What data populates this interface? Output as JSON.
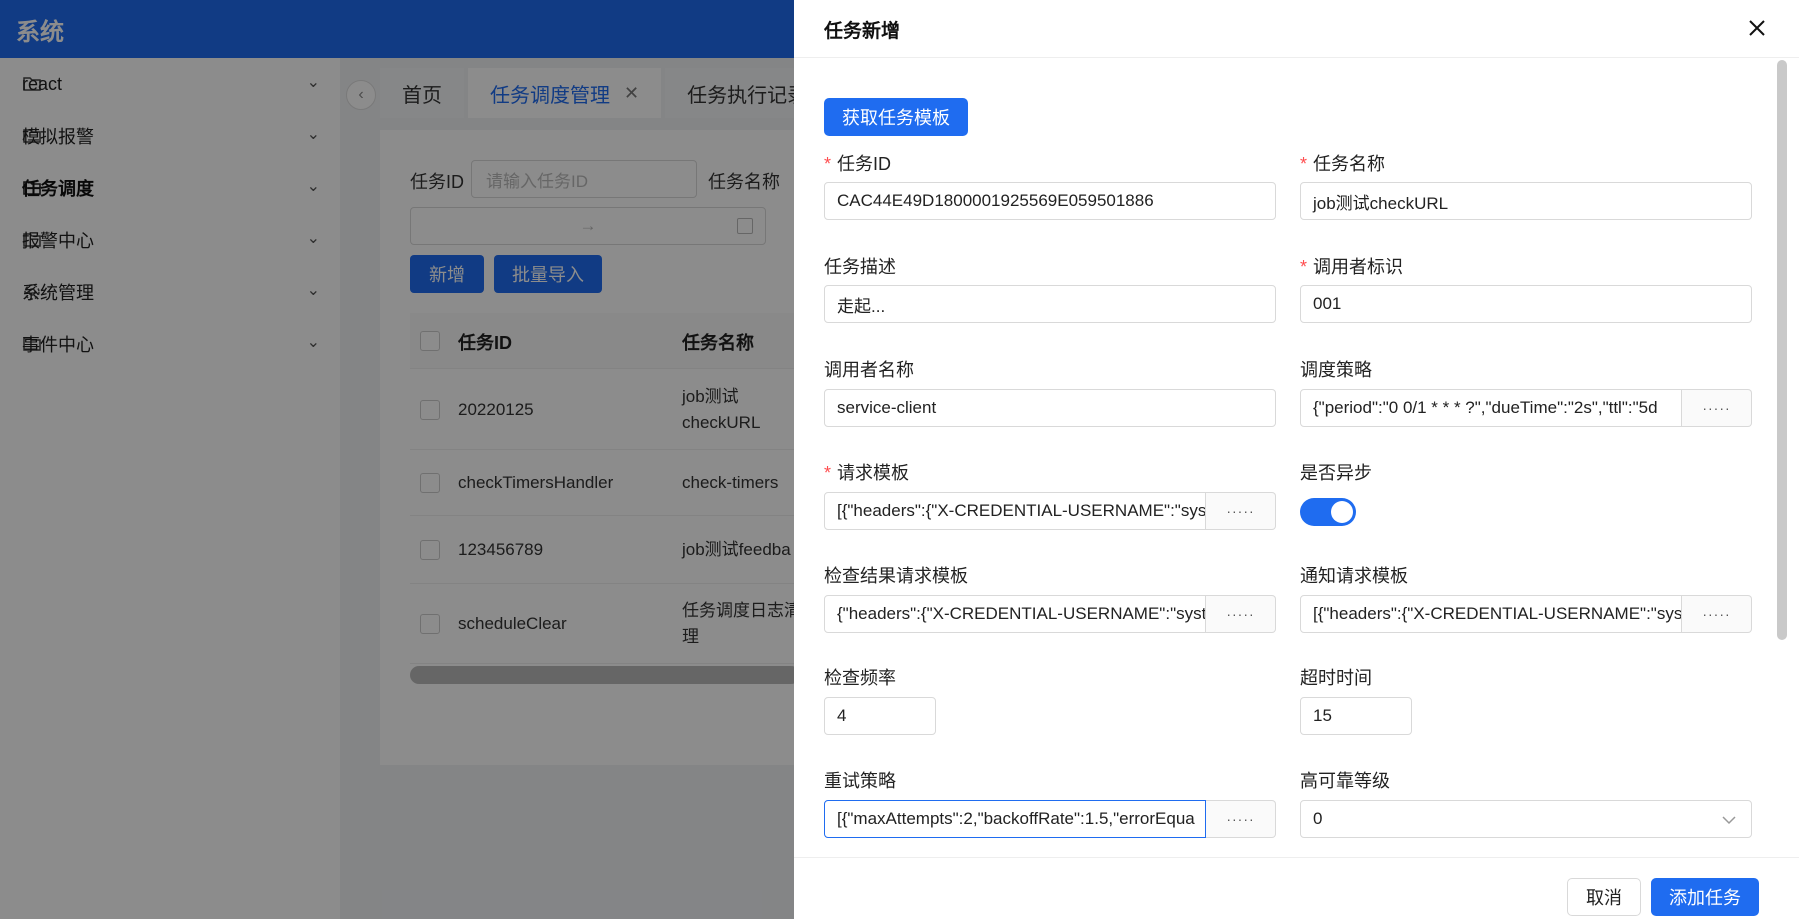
{
  "app": {
    "title": "系统"
  },
  "sidebar": {
    "items": [
      {
        "label": "react",
        "icon": "folder-icon"
      },
      {
        "label": "模拟报警",
        "icon": "folder-icon"
      },
      {
        "label": "任务调度",
        "icon": "folder-icon"
      },
      {
        "label": "报警中心",
        "icon": "folder-icon"
      },
      {
        "label": "系统管理",
        "icon": "gear-icon"
      },
      {
        "label": "事件中心",
        "icon": "folder-icon"
      }
    ]
  },
  "tabs": [
    {
      "label": "首页"
    },
    {
      "label": "任务调度管理"
    },
    {
      "label": "任务执行记录"
    }
  ],
  "search": {
    "task_id_label": "任务ID",
    "task_id_placeholder": "请输入任务ID",
    "task_name_label": "任务名称",
    "date_sep": "→"
  },
  "toolbar": {
    "add_label": "新增",
    "import_label": "批量导入"
  },
  "table": {
    "headers": [
      "任务ID",
      "任务名称"
    ],
    "rows": [
      {
        "id": "20220125",
        "name": "job测试\ncheckURL"
      },
      {
        "id": "checkTimersHandler",
        "name": "check-timers"
      },
      {
        "id": "123456789",
        "name": "job测试feedba"
      },
      {
        "id": "scheduleClear",
        "name": "任务调度日志清\n理"
      }
    ]
  },
  "drawer": {
    "title": "任务新增",
    "template_button": "获取任务模板",
    "fields": {
      "task_id": {
        "label": "任务ID",
        "value": "CAC44E49D1800001925569E059501886"
      },
      "task_name": {
        "label": "任务名称",
        "value": "job测试checkURL"
      },
      "task_desc": {
        "label": "任务描述",
        "value": "走起..."
      },
      "caller_id": {
        "label": "调用者标识",
        "value": "001"
      },
      "caller_name": {
        "label": "调用者名称",
        "value": "service-client"
      },
      "schedule_policy": {
        "label": "调度策略",
        "value": "{\"period\":\"0 0/1 * * * ?\",\"dueTime\":\"2s\",\"ttl\":\"5d"
      },
      "request_template": {
        "label": "请求模板",
        "value": "[{\"headers\":{\"X-CREDENTIAL-USERNAME\":\"syst"
      },
      "async": {
        "label": "是否异步"
      },
      "check_template": {
        "label": "检查结果请求模板",
        "value": "{\"headers\":{\"X-CREDENTIAL-USERNAME\":\"syste"
      },
      "notify_template": {
        "label": "通知请求模板",
        "value": "[{\"headers\":{\"X-CREDENTIAL-USERNAME\":\"syst"
      },
      "check_freq": {
        "label": "检查频率",
        "value": "4"
      },
      "timeout": {
        "label": "超时时间",
        "value": "15"
      },
      "retry_policy": {
        "label": "重试策略",
        "value": "[{\"maxAttempts\":2,\"backoffRate\":1.5,\"errorEqua"
      },
      "ha_level": {
        "label": "高可靠等级",
        "value": "0"
      }
    },
    "addon_text": "·····",
    "cancel_label": "取消",
    "submit_label": "添加任务"
  },
  "colors": {
    "primary": "#1f6cf0",
    "required": "#ff4d4f"
  }
}
